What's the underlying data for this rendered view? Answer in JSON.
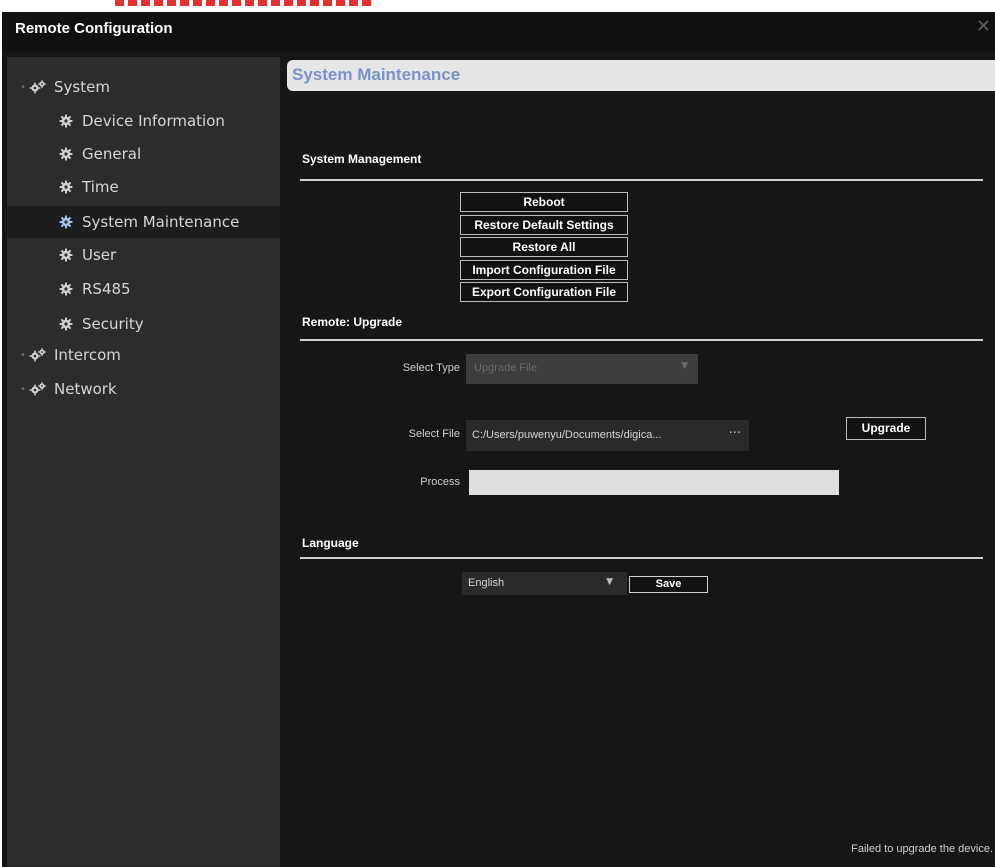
{
  "window": {
    "title": "Remote Configuration",
    "close_glyph": "✕"
  },
  "sidebar": {
    "items": [
      {
        "label": "System",
        "level": 0,
        "icon": "gears-icon",
        "expanded": true
      },
      {
        "label": "Device Information",
        "level": 1,
        "icon": "gear-icon"
      },
      {
        "label": "General",
        "level": 1,
        "icon": "gear-icon"
      },
      {
        "label": "Time",
        "level": 1,
        "icon": "gear-icon"
      },
      {
        "label": "System Maintenance",
        "level": 1,
        "icon": "gear-icon",
        "selected": true
      },
      {
        "label": "User",
        "level": 1,
        "icon": "gear-icon"
      },
      {
        "label": "RS485",
        "level": 1,
        "icon": "gear-icon"
      },
      {
        "label": "Security",
        "level": 1,
        "icon": "gear-icon"
      },
      {
        "label": "Intercom",
        "level": 0,
        "icon": "gears-icon",
        "expanded": false
      },
      {
        "label": "Network",
        "level": 0,
        "icon": "gears-icon",
        "expanded": false
      }
    ]
  },
  "main": {
    "title": "System Maintenance",
    "system_management": {
      "title": "System Management",
      "buttons": [
        "Reboot",
        "Restore Default Settings",
        "Restore All",
        "Import Configuration File",
        "Export Configuration File"
      ]
    },
    "remote_upgrade": {
      "title": "Remote: Upgrade",
      "select_type_label": "Select Type",
      "select_type_value": "Upgrade File",
      "select_file_label": "Select File",
      "select_file_value": "C:/Users/puwenyu/Documents/digica...",
      "browse_glyph": "···",
      "upgrade_label": "Upgrade",
      "process_label": "Process",
      "progress": 0
    },
    "language": {
      "title": "Language",
      "value": "English",
      "save_label": "Save"
    },
    "status": "Failed to upgrade the device."
  },
  "colors": {
    "window_bg": "#161616",
    "sidebar_bg": "#2c2c2c",
    "header_bg": "#e6e6e6",
    "header_text": "#7b93c8",
    "selected_icon": "#9fc3ea"
  }
}
